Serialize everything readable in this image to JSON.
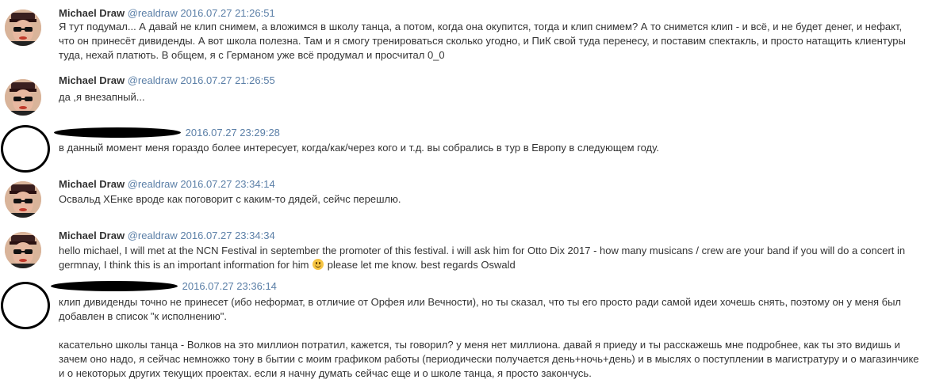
{
  "messages": [
    {
      "author": "Michael Draw",
      "handle": "@realdraw",
      "time": "2016.07.27 21:26:51",
      "text": "Я тут подумал... А давай не клип снимем, а вложимся в школу танца, а потом, когда она окупится, тогда и клип снимем? А то снимется клип - и всё, и не будет денег, и нефакт, что он принесёт дивиденды. А вот школа полезна. Там и я смогу тренироваться сколько угодно, и ПиК свой туда перенесу, и поставим спектакль, и просто натащить клиентуры туда, нехай платють. В общем, я с Германом уже всё продумал и просчитал 0_0"
    },
    {
      "author": "Michael Draw",
      "handle": "@realdraw",
      "time": "2016.07.27 21:26:55",
      "text": "да ,я внезапный..."
    },
    {
      "time": "2016.07.27 23:29:28",
      "text": "в данный момент меня гораздо более интересует, когда/как/через кого и т.д. вы собрались в тур в Европу в следующем году."
    },
    {
      "author": "Michael Draw",
      "handle": "@realdraw",
      "time": "2016.07.27 23:34:14",
      "text": "Освальд ХЕнке вроде как поговорит с каким-то дядей, сейчс перешлю."
    },
    {
      "author": "Michael Draw",
      "handle": "@realdraw",
      "time": "2016.07.27 23:34:34",
      "text_before_emoji": "hello michael, I will met at the NCN Festival in september the promoter of this festival. i will ask him for Otto Dix 2017 - how many musicans / crew are your band if you will do a concert in germnay, I think this is an important information for him",
      "text_after_emoji": " please let me know. best regards Oswald"
    },
    {
      "time": "2016.07.27 23:36:14",
      "paragraph1": "клип дивиденды точно не принесет (ибо неформат, в отличие от Орфея или Вечности), но ты сказал, что ты его просто ради самой идеи хочешь снять, поэтому он у меня был добавлен в список \"к исполнению\".",
      "paragraph2": "касательно школы танца - Волков на это миллион потратил, кажется, ты говорил? у меня нет миллиона. давай я приеду и ты расскажешь мне подробнее, как ты это видишь и зачем оно надо, я сейчас немножко тону в бытии с моим графиком работы (периодически получается день+ночь+день) и в мыслях о поступлении в магистратуру и о магазинчике и о некоторых других текущих проектах. если я начну думать сейчас еще и о школе танца, я просто закончусь."
    }
  ],
  "icons": {
    "avatar": "avatar-portrait-icon",
    "emoji": "smiley-emoji-icon"
  },
  "colors": {
    "link": "#5b7fa7",
    "text": "#333333",
    "avatar_bg": "#d9b49a"
  }
}
